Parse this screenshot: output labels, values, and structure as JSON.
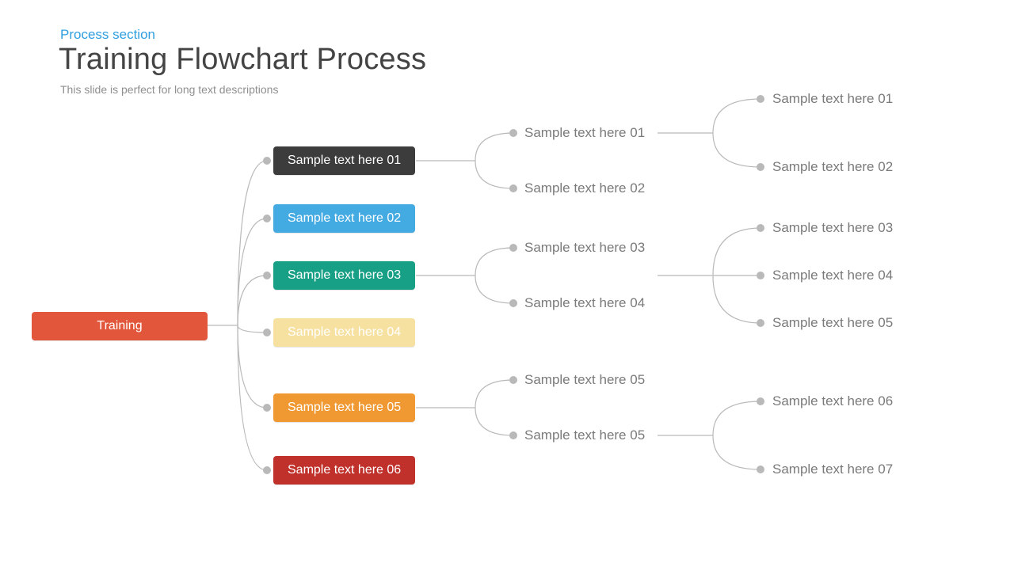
{
  "section": "Process section",
  "title": "Training Flowchart Process",
  "subtitle": "This slide is perfect for long text descriptions",
  "root": {
    "label": "Training",
    "color": "#E2573C"
  },
  "level1": [
    {
      "label": "Sample text here 01",
      "color": "#3C3C3C"
    },
    {
      "label": "Sample text here 02",
      "color": "#44AAE2"
    },
    {
      "label": "Sample text here 03",
      "color": "#17A086"
    },
    {
      "label": "Sample text here 04",
      "color": "#F7E1A1"
    },
    {
      "label": "Sample text here 05",
      "color": "#F09933"
    },
    {
      "label": "Sample text here 06",
      "color": "#C0312B"
    }
  ],
  "level2": {
    "group1": [
      "Sample text here 01",
      "Sample text here 02"
    ],
    "group2": [
      "Sample text here 03",
      "Sample text here 04"
    ],
    "group3": [
      "Sample text here 05",
      "Sample text here 05"
    ]
  },
  "level3": {
    "group1": [
      "Sample text here 01",
      "Sample text here 02"
    ],
    "group2": [
      "Sample text here 03",
      "Sample text here 04",
      "Sample text here 05"
    ],
    "group3": [
      "Sample text here 06",
      "Sample text here 07"
    ]
  }
}
